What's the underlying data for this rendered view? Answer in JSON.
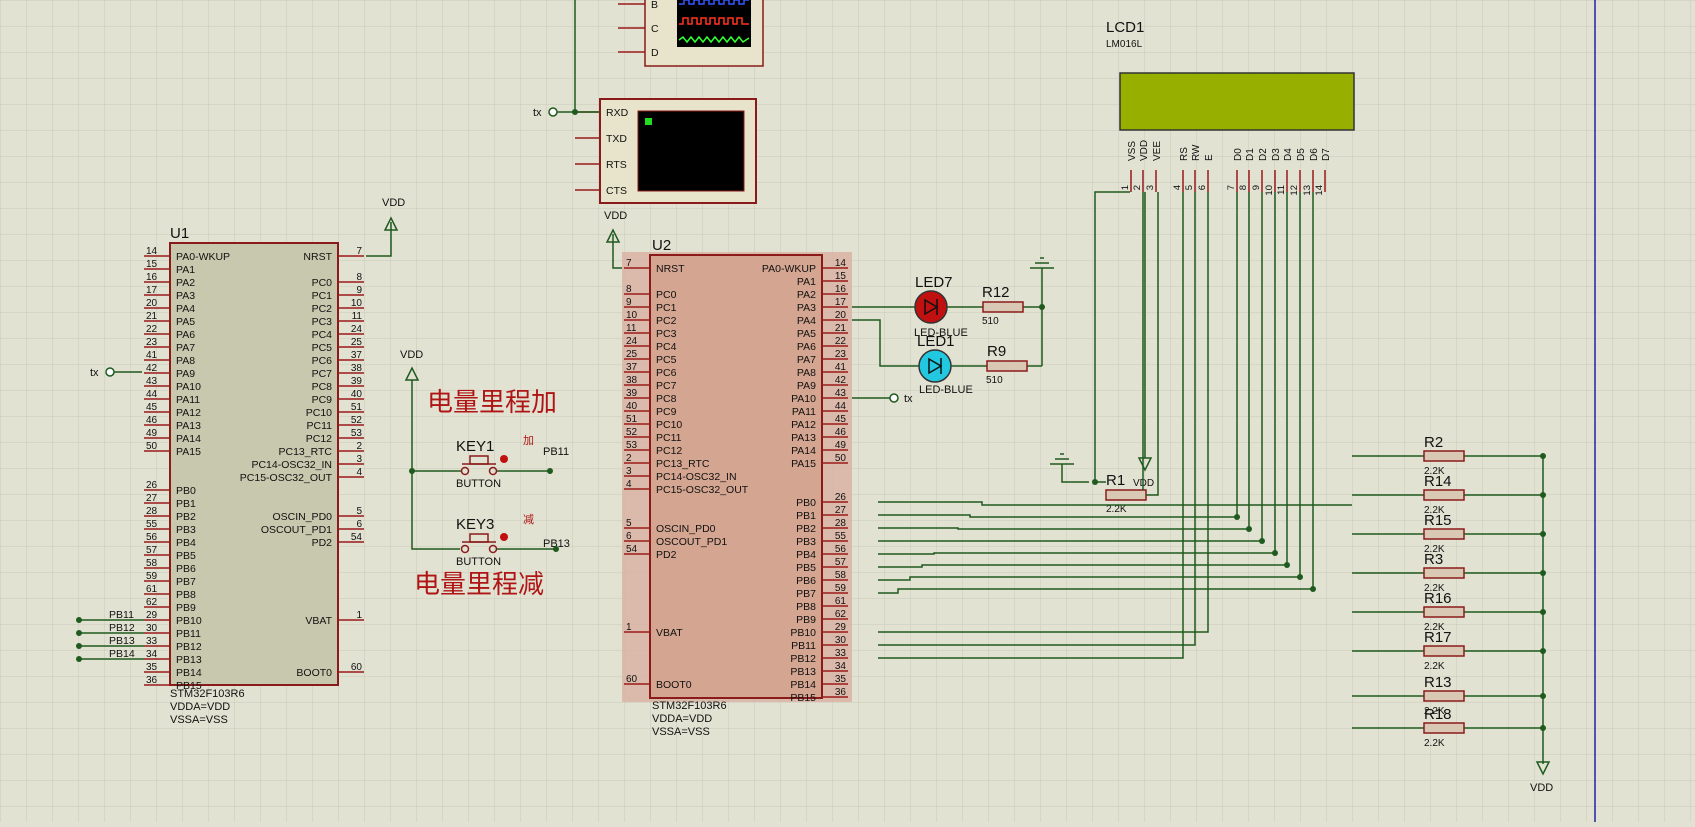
{
  "colors": {
    "background": "#e2e2d3",
    "grid": "#c9c9bb",
    "wire": "#1f5a1f",
    "pin": "#9a1a1a",
    "chip_u1_fill": "#c8c8ae",
    "chip_u2_fill": "#d4a590",
    "chip_outline": "#8b1a1a",
    "lcd_screen": "#97b000",
    "led_red": "#c01010",
    "led_cyan": "#21c8e0",
    "text": "#111111",
    "cn_label": "#b01515"
  },
  "u1": {
    "ref": "U1",
    "part": "STM32F103R6",
    "note1": "VDDA=VDD",
    "note2": "VSSA=VSS",
    "vdd": "VDD",
    "tx": "tx",
    "left": [
      [
        "14",
        "PA0-WKUP"
      ],
      [
        "15",
        "PA1"
      ],
      [
        "16",
        "PA2"
      ],
      [
        "17",
        "PA3"
      ],
      [
        "20",
        "PA4"
      ],
      [
        "21",
        "PA5"
      ],
      [
        "22",
        "PA6"
      ],
      [
        "23",
        "PA7"
      ],
      [
        "41",
        "PA8"
      ],
      [
        "42",
        "PA9"
      ],
      [
        "43",
        "PA10"
      ],
      [
        "44",
        "PA11"
      ],
      [
        "45",
        "PA12"
      ],
      [
        "46",
        "PA13"
      ],
      [
        "49",
        "PA14"
      ],
      [
        "50",
        "PA15"
      ],
      [
        "26",
        "PB0"
      ],
      [
        "27",
        "PB1"
      ],
      [
        "28",
        "PB2"
      ],
      [
        "55",
        "PB3"
      ],
      [
        "56",
        "PB4"
      ],
      [
        "57",
        "PB5"
      ],
      [
        "58",
        "PB6"
      ],
      [
        "59",
        "PB7"
      ],
      [
        "61",
        "PB8"
      ],
      [
        "62",
        "PB9"
      ],
      [
        "29",
        "PB10"
      ],
      [
        "30",
        "PB11"
      ],
      [
        "33",
        "PB12"
      ],
      [
        "34",
        "PB13"
      ],
      [
        "35",
        "PB14"
      ],
      [
        "36",
        "PB15"
      ]
    ],
    "right_top": [
      [
        "7",
        "NRST"
      ]
    ],
    "right_pc": [
      [
        "8",
        "PC0"
      ],
      [
        "9",
        "PC1"
      ],
      [
        "10",
        "PC2"
      ],
      [
        "11",
        "PC3"
      ],
      [
        "24",
        "PC4"
      ],
      [
        "25",
        "PC5"
      ],
      [
        "37",
        "PC6"
      ],
      [
        "38",
        "PC7"
      ],
      [
        "39",
        "PC8"
      ],
      [
        "40",
        "PC9"
      ],
      [
        "51",
        "PC10"
      ],
      [
        "52",
        "PC11"
      ],
      [
        "53",
        "PC12"
      ],
      [
        "2",
        "PC13_RTC"
      ],
      [
        "3",
        "PC14-OSC32_IN"
      ],
      [
        "4",
        "PC15-OSC32_OUT"
      ]
    ],
    "right_osc": [
      [
        "5",
        "OSCIN_PD0"
      ],
      [
        "6",
        "OSCOUT_PD1"
      ],
      [
        "54",
        "PD2"
      ]
    ],
    "right_vbat": [
      [
        "1",
        "VBAT"
      ]
    ],
    "right_boot": [
      [
        "60",
        "BOOT0"
      ]
    ],
    "ext_labels": [
      "PB11",
      "PB12",
      "PB13",
      "PB14"
    ]
  },
  "u2": {
    "ref": "U2",
    "part": "STM32F103R6",
    "note1": "VDDA=VDD",
    "note2": "VSSA=VSS",
    "vdd": "VDD",
    "tx": "tx",
    "left_top": [
      [
        "7",
        "NRST"
      ]
    ],
    "left_pc": [
      [
        "8",
        "PC0"
      ],
      [
        "9",
        "PC1"
      ],
      [
        "10",
        "PC2"
      ],
      [
        "11",
        "PC3"
      ],
      [
        "24",
        "PC4"
      ],
      [
        "25",
        "PC5"
      ],
      [
        "37",
        "PC6"
      ],
      [
        "38",
        "PC7"
      ],
      [
        "39",
        "PC8"
      ],
      [
        "40",
        "PC9"
      ],
      [
        "51",
        "PC10"
      ],
      [
        "52",
        "PC11"
      ],
      [
        "53",
        "PC12"
      ],
      [
        "2",
        "PC13_RTC"
      ],
      [
        "3",
        "PC14-OSC32_IN"
      ],
      [
        "4",
        "PC15-OSC32_OUT"
      ]
    ],
    "left_osc": [
      [
        "5",
        "OSCIN_PD0"
      ],
      [
        "6",
        "OSCOUT_PD1"
      ],
      [
        "54",
        "PD2"
      ]
    ],
    "left_vbat": [
      [
        "1",
        "VBAT"
      ]
    ],
    "left_boot": [
      [
        "60",
        "BOOT0"
      ]
    ],
    "right": [
      [
        "14",
        "PA0-WKUP"
      ],
      [
        "15",
        "PA1"
      ],
      [
        "16",
        "PA2"
      ],
      [
        "17",
        "PA3"
      ],
      [
        "20",
        "PA4"
      ],
      [
        "21",
        "PA5"
      ],
      [
        "22",
        "PA6"
      ],
      [
        "23",
        "PA7"
      ],
      [
        "41",
        "PA8"
      ],
      [
        "42",
        "PA9"
      ],
      [
        "43",
        "PA10"
      ],
      [
        "44",
        "PA11"
      ],
      [
        "45",
        "PA12"
      ],
      [
        "46",
        "PA13"
      ],
      [
        "49",
        "PA14"
      ],
      [
        "50",
        "PA15"
      ],
      [
        "26",
        "PB0"
      ],
      [
        "27",
        "PB1"
      ],
      [
        "28",
        "PB2"
      ],
      [
        "55",
        "PB3"
      ],
      [
        "56",
        "PB4"
      ],
      [
        "57",
        "PB5"
      ],
      [
        "58",
        "PB6"
      ],
      [
        "59",
        "PB7"
      ],
      [
        "61",
        "PB8"
      ],
      [
        "62",
        "PB9"
      ],
      [
        "29",
        "PB10"
      ],
      [
        "30",
        "PB11"
      ],
      [
        "33",
        "PB12"
      ],
      [
        "34",
        "PB13"
      ],
      [
        "35",
        "PB14"
      ],
      [
        "36",
        "PB15"
      ]
    ]
  },
  "terminal": {
    "pins": [
      "RXD",
      "TXD",
      "RTS",
      "CTS"
    ],
    "tx": "tx"
  },
  "scope": {
    "pins": [
      "B",
      "C",
      "D"
    ]
  },
  "lcd": {
    "ref": "LCD1",
    "part": "LM016L",
    "pins": [
      [
        "1",
        "VSS"
      ],
      [
        "2",
        "VDD"
      ],
      [
        "3",
        "VEE"
      ],
      [
        "4",
        "RS"
      ],
      [
        "5",
        "RW"
      ],
      [
        "6",
        "E"
      ],
      [
        "7",
        "D0"
      ],
      [
        "8",
        "D1"
      ],
      [
        "9",
        "D2"
      ],
      [
        "10",
        "D3"
      ],
      [
        "11",
        "D4"
      ],
      [
        "12",
        "D5"
      ],
      [
        "13",
        "D6"
      ],
      [
        "14",
        "D7"
      ]
    ]
  },
  "leds": [
    {
      "ref": "LED7",
      "type": "LED-BLUE"
    },
    {
      "ref": "LED1",
      "type": "LED-BLUE"
    }
  ],
  "resistors": [
    {
      "ref": "R12",
      "value": "510"
    },
    {
      "ref": "R9",
      "value": "510"
    },
    {
      "ref": "R1",
      "value": "2.2K",
      "vdd": "VDD"
    },
    {
      "ref": "R2",
      "value": "2.2K"
    },
    {
      "ref": "R14",
      "value": "2.2K"
    },
    {
      "ref": "R15",
      "value": "2.2K"
    },
    {
      "ref": "R3",
      "value": "2.2K"
    },
    {
      "ref": "R16",
      "value": "2.2K"
    },
    {
      "ref": "R17",
      "value": "2.2K"
    },
    {
      "ref": "R13",
      "value": "2.2K"
    },
    {
      "ref": "R18",
      "value": "2.2K"
    }
  ],
  "buttons": {
    "vdd": "VDD",
    "key1": {
      "ref": "KEY1",
      "type": "BUTTON",
      "tag": "加",
      "net": "PB11"
    },
    "key3": {
      "ref": "KEY3",
      "type": "BUTTON",
      "tag": "减",
      "net": "PB13"
    },
    "label_add": "电量里程加",
    "label_sub": "电量里程减"
  },
  "pullup_vdd": "VDD"
}
